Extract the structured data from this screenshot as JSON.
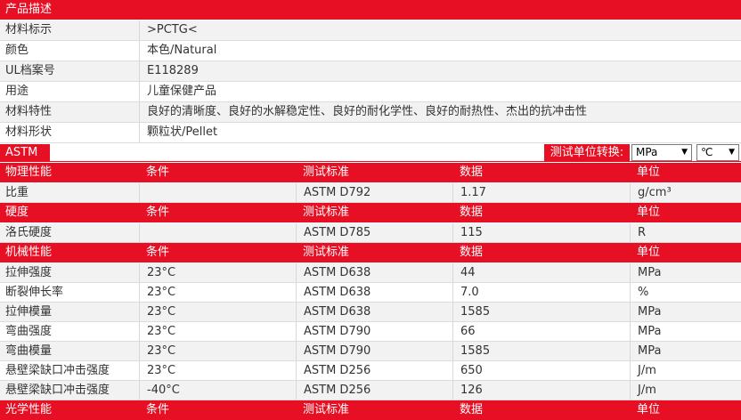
{
  "product": {
    "header": "产品描述",
    "rows": [
      {
        "label": "材料标示",
        "value": ">PCTG<"
      },
      {
        "label": "颜色",
        "value": "本色/Natural"
      },
      {
        "label": "UL档案号",
        "value": "E118289"
      },
      {
        "label": "用途",
        "value": "儿童保健产品"
      },
      {
        "label": "材料特性",
        "value": "良好的清晰度、良好的水解稳定性、良好的耐化学性、良好的耐热性、杰出的抗冲击性"
      },
      {
        "label": "材料形状",
        "value": "颗粒状/Pellet"
      }
    ]
  },
  "standard": {
    "tag": "ASTM",
    "converter_label": "测试单位转换:",
    "pressure_unit": "MPa",
    "temp_unit": "℃",
    "caret": "▼"
  },
  "columns": {
    "condition": "条件",
    "test_standard": "测试标准",
    "data": "数据",
    "unit": "单位"
  },
  "sections": [
    {
      "title": "物理性能",
      "rows": [
        {
          "property": "比重",
          "condition": "",
          "standard": "ASTM D792",
          "value": "1.17",
          "unit": "g/cm³"
        }
      ]
    },
    {
      "title": "硬度",
      "rows": [
        {
          "property": "洛氏硬度",
          "condition": "",
          "standard": "ASTM D785",
          "value": "115",
          "unit": "R"
        }
      ]
    },
    {
      "title": "机械性能",
      "rows": [
        {
          "property": "拉伸强度",
          "condition": "23°C",
          "standard": "ASTM D638",
          "value": "44",
          "unit": "MPa"
        },
        {
          "property": "断裂伸长率",
          "condition": "23°C",
          "standard": "ASTM D638",
          "value": "7.0",
          "unit": "%"
        },
        {
          "property": "拉伸模量",
          "condition": "23°C",
          "standard": "ASTM D638",
          "value": "1585",
          "unit": "MPa"
        },
        {
          "property": "弯曲强度",
          "condition": "23°C",
          "standard": "ASTM D790",
          "value": "66",
          "unit": "MPa"
        },
        {
          "property": "弯曲模量",
          "condition": "23°C",
          "standard": "ASTM D790",
          "value": "1585",
          "unit": "MPa"
        },
        {
          "property": "悬壁梁缺口冲击强度",
          "condition": "23°C",
          "standard": "ASTM D256",
          "value": "650",
          "unit": "J/m"
        },
        {
          "property": "悬壁梁缺口冲击强度",
          "condition": "-40°C",
          "standard": "ASTM D256",
          "value": "126",
          "unit": "J/m"
        }
      ]
    },
    {
      "title": "光学性能",
      "rows": []
    }
  ],
  "colors": {
    "accent": "#e60f23",
    "row_alt": "#f2f2f2",
    "row": "#ffffff",
    "text": "#333333"
  }
}
